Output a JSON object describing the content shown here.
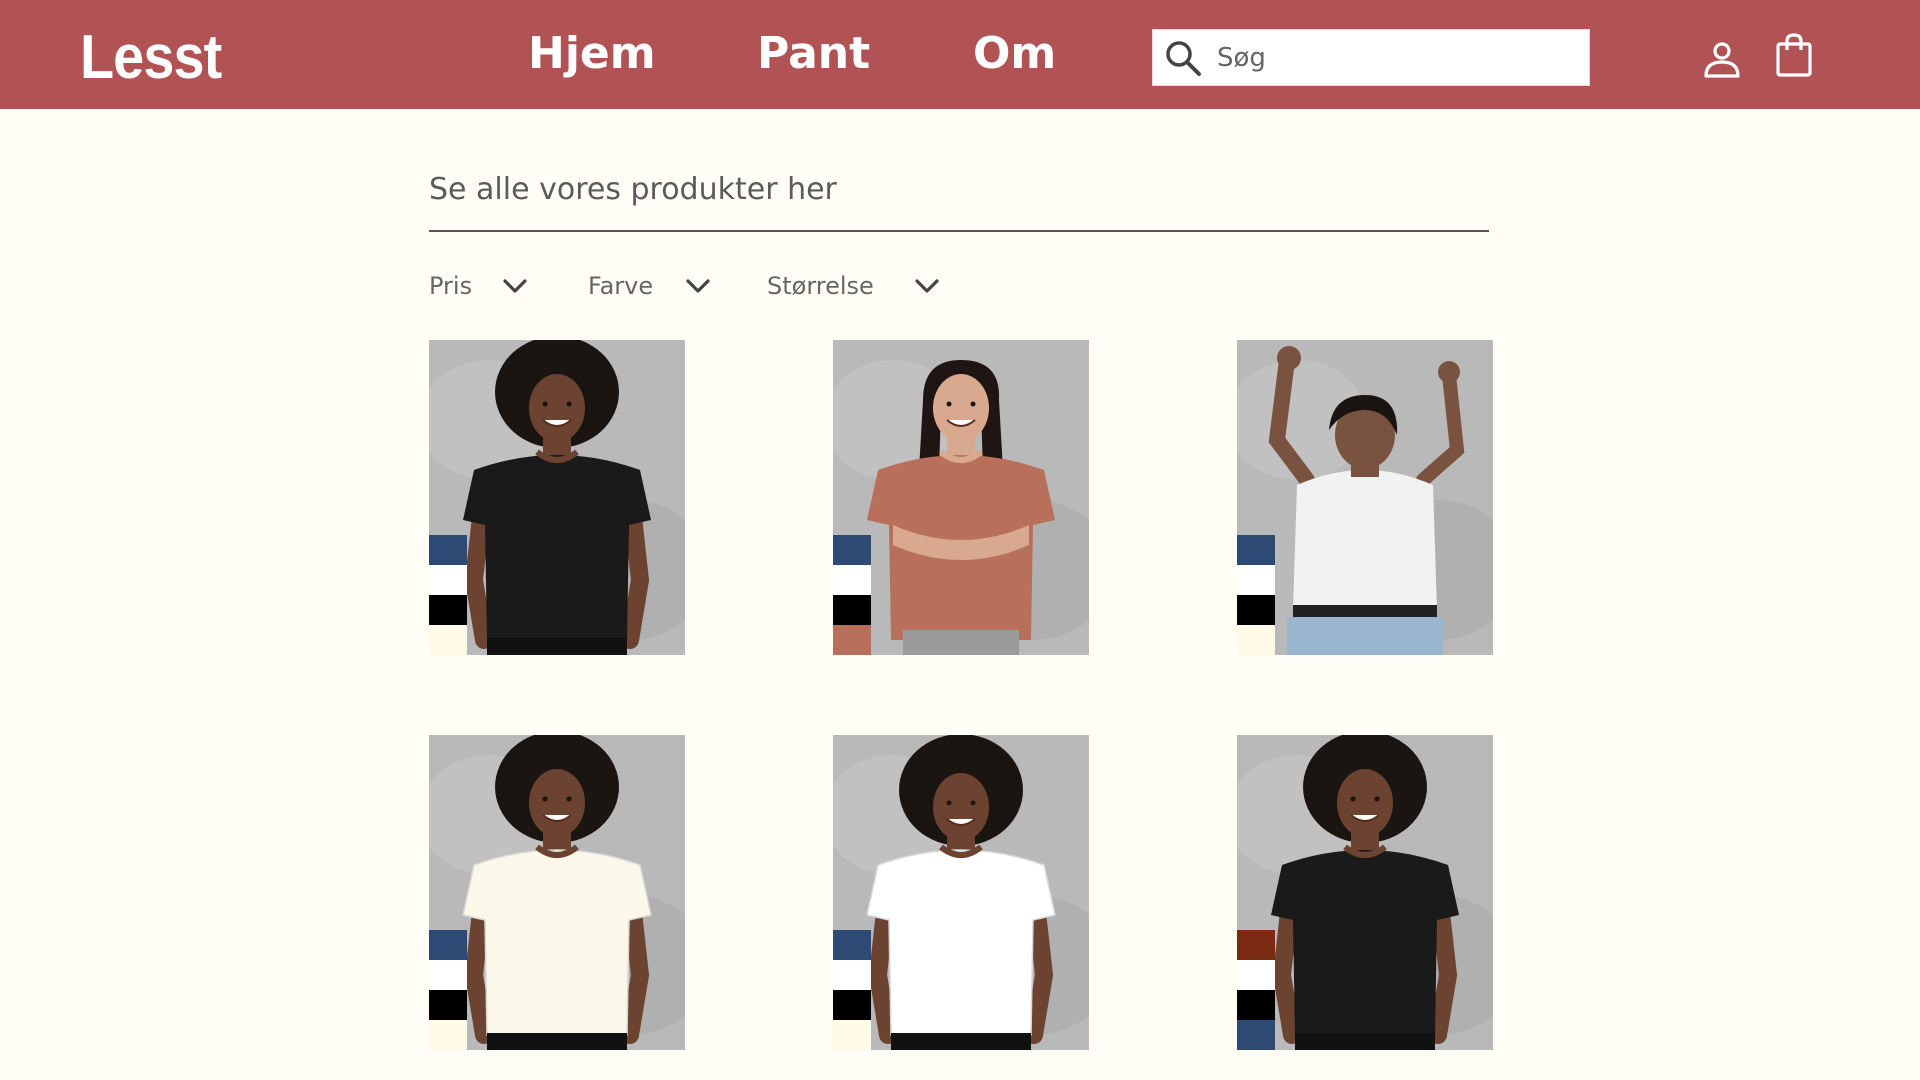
{
  "header": {
    "logo": "Lesst",
    "nav": [
      "Hjem",
      "Pant",
      "Om"
    ],
    "search_placeholder": "Søg",
    "icons": [
      "search-icon",
      "user-icon",
      "shopping-bag-icon"
    ],
    "colors": {
      "bar": "#b15355",
      "text": "#ffffff"
    }
  },
  "main": {
    "tagline": "Se alle vores produkter her",
    "filters": [
      {
        "label": "Pris"
      },
      {
        "label": "Farve"
      },
      {
        "label": "Størrelse"
      }
    ]
  },
  "products": [
    {
      "shirt_color": "#1a1a1a",
      "skin": "#6b4330",
      "hair": "#1b1512",
      "pose": "curly",
      "swatches": [
        "#2c4a74",
        "#ffffff",
        "#000000",
        "#fffbe6"
      ]
    },
    {
      "shirt_color": "#b8705a",
      "skin": "#d9a98f",
      "hair": "#1f1614",
      "pose": "arms-crossed",
      "swatches": [
        "#2c4a74",
        "#ffffff",
        "#000000",
        "#b8705a"
      ]
    },
    {
      "shirt_color": "#f2f2f2",
      "skin": "#7a5340",
      "hair": "#1b1512",
      "pose": "cheer",
      "swatches": [
        "#2c4a74",
        "#ffffff",
        "#000000",
        "#fffbe6"
      ]
    },
    {
      "shirt_color": "#fbf8ea",
      "skin": "#6b4330",
      "hair": "#1b1512",
      "pose": "curly",
      "swatches": [
        "#2c4a74",
        "#ffffff",
        "#000000",
        "#fffbe6"
      ]
    },
    {
      "shirt_color": "#ffffff",
      "skin": "#6b4330",
      "hair": "#1b1512",
      "pose": "curly-down",
      "swatches": [
        "#2c4a74",
        "#ffffff",
        "#000000",
        "#fffbe6"
      ]
    },
    {
      "shirt_color": "#1a1a1a",
      "skin": "#6b4330",
      "hair": "#1b1512",
      "pose": "curly",
      "swatches": [
        "#7a2a10",
        "#ffffff",
        "#000000",
        "#2c4a74"
      ]
    }
  ]
}
